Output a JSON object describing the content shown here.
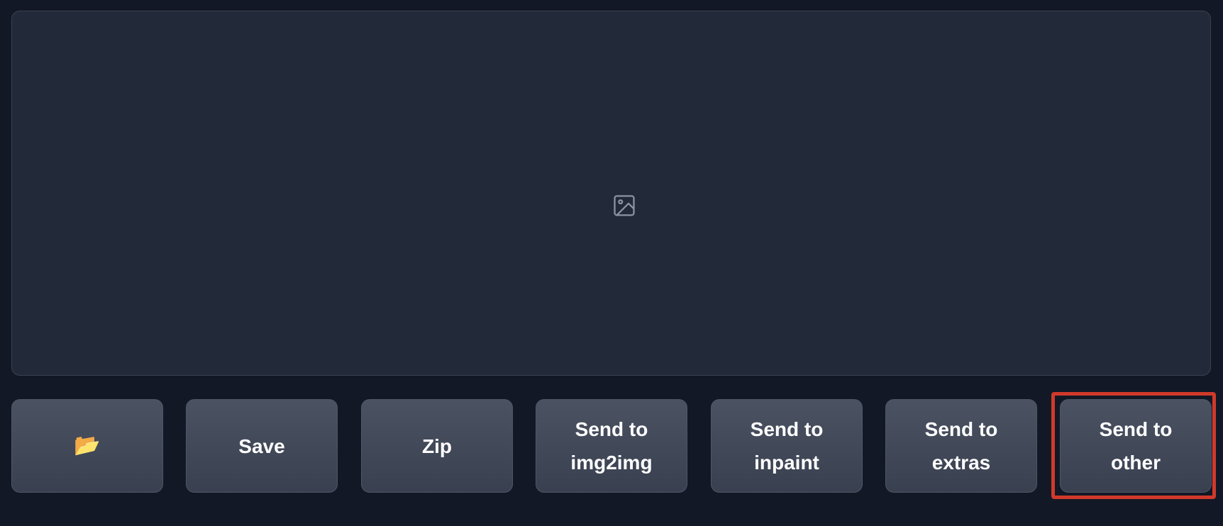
{
  "gallery": {
    "placeholder_icon": "image-icon"
  },
  "buttons": {
    "open_folder": {
      "icon": "folder-icon",
      "glyph": "📂"
    },
    "save": {
      "label": "Save"
    },
    "zip": {
      "label": "Zip"
    },
    "send_img2img": {
      "line1": "Send to",
      "line2": "img2img"
    },
    "send_inpaint": {
      "line1": "Send to",
      "line2": "inpaint"
    },
    "send_extras": {
      "line1": "Send to",
      "line2": "extras"
    },
    "send_other": {
      "line1": "Send to",
      "line2": "other"
    }
  },
  "colors": {
    "background": "#121826",
    "panel": "#222938",
    "button_top": "#4b5262",
    "button_bottom": "#394050",
    "highlight": "#d0392b"
  }
}
